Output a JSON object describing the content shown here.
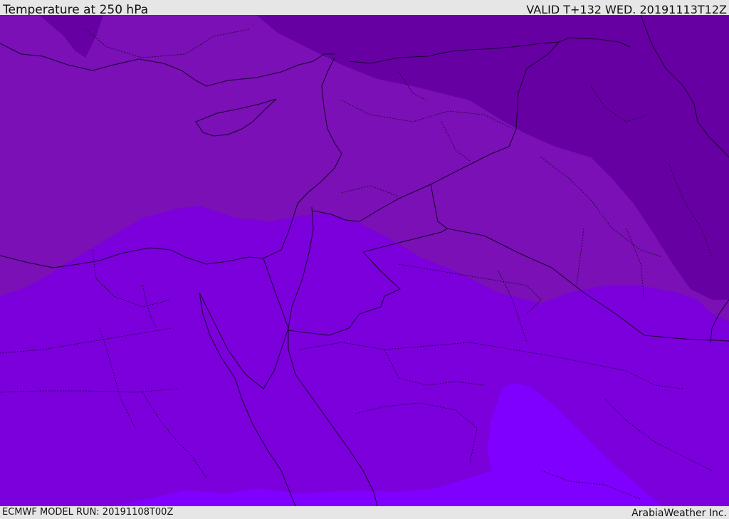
{
  "header": {
    "title": "Temperature at 250 hPa",
    "valid": "VALID T+132 WED. 20191113T12Z"
  },
  "footer": {
    "model_run": "ECMWF MODEL RUN: 20191108T00Z",
    "credit": "ArabiaWeather Inc."
  },
  "colors": {
    "band_darkest": "#6600a3",
    "band_dark": "#7a10b5",
    "band_mid": "#7b00dc",
    "band_light": "#7f00ff",
    "coastline": "#1a0030",
    "border": "#1a0030"
  }
}
